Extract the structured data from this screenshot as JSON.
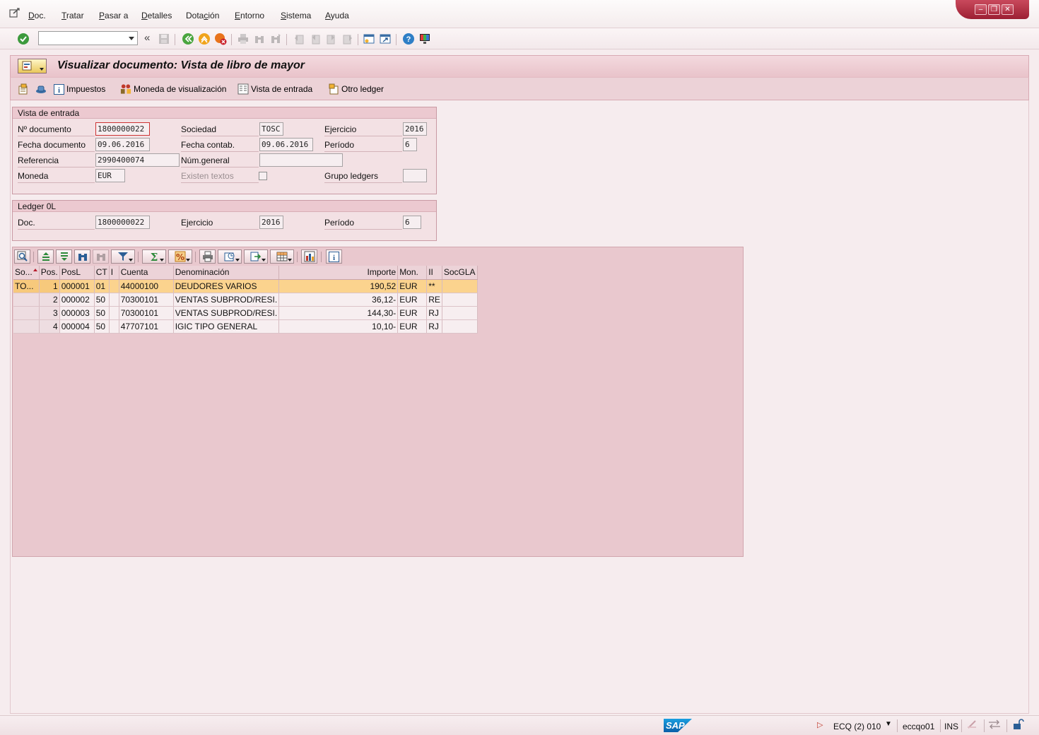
{
  "menubar": {
    "items": [
      {
        "pre": "",
        "u": "D",
        "post": "oc."
      },
      {
        "pre": "",
        "u": "T",
        "post": "ratar"
      },
      {
        "pre": "",
        "u": "P",
        "post": "asar a"
      },
      {
        "pre": "",
        "u": "D",
        "post": "etalles"
      },
      {
        "pre": "Dota",
        "u": "c",
        "post": "ión"
      },
      {
        "pre": "",
        "u": "E",
        "post": "ntorno"
      },
      {
        "pre": "",
        "u": "S",
        "post": "istema"
      },
      {
        "pre": "",
        "u": "A",
        "post": "yuda"
      }
    ]
  },
  "toolbar": {
    "command_value": ""
  },
  "title": "Visualizar documento: Vista de libro de mayor",
  "app_toolbar": {
    "impuestos": "Impuestos",
    "moneda": "Moneda de visualización",
    "vista_entrada": "Vista de entrada",
    "otro_ledger": "Otro ledger"
  },
  "entry_view": {
    "heading": "Vista de entrada",
    "doc_no_label": "Nº documento",
    "doc_no": "1800000022",
    "company_label": "Sociedad",
    "company": "TOSC",
    "fiscal_year_label": "Ejercicio",
    "fiscal_year": "2016",
    "doc_date_label": "Fecha documento",
    "doc_date": "09.06.2016",
    "posting_date_label": "Fecha contab.",
    "posting_date": "09.06.2016",
    "period_label": "Período",
    "period": "6",
    "reference_label": "Referencia",
    "reference": "2990400074",
    "crossco_label": "Núm.general",
    "crossco": "",
    "currency_label": "Moneda",
    "currency": "EUR",
    "texts_label": "Existen textos",
    "ledger_group_label": "Grupo ledgers",
    "ledger_group": ""
  },
  "ledger": {
    "heading": "Ledger 0L",
    "doc_label": "Doc.",
    "doc": "1800000022",
    "fiscal_year_label": "Ejercicio",
    "fiscal_year": "2016",
    "period_label": "Período",
    "period": "6"
  },
  "grid": {
    "columns": [
      "So...",
      "Pos.",
      "PosL",
      "CT",
      "I",
      "Cuenta",
      "Denominación",
      "Importe",
      "Mon.",
      "II",
      "SocGLA"
    ],
    "rows": [
      {
        "so": "TO...",
        "pos": "1",
        "posl": "000001",
        "ct": "01",
        "i": "",
        "cuenta": "44000100",
        "denom": "DEUDORES VARIOS",
        "importe": "190,52",
        "mon": "EUR",
        "ii": "**",
        "socgla": ""
      },
      {
        "so": "",
        "pos": "2",
        "posl": "000002",
        "ct": "50",
        "i": "",
        "cuenta": "70300101",
        "denom": "VENTAS SUBPROD/RESI.",
        "importe": "36,12-",
        "mon": "EUR",
        "ii": "RE",
        "socgla": ""
      },
      {
        "so": "",
        "pos": "3",
        "posl": "000003",
        "ct": "50",
        "i": "",
        "cuenta": "70300101",
        "denom": "VENTAS SUBPROD/RESI.",
        "importe": "144,30-",
        "mon": "EUR",
        "ii": "RJ",
        "socgla": ""
      },
      {
        "so": "",
        "pos": "4",
        "posl": "000004",
        "ct": "50",
        "i": "",
        "cuenta": "47707101",
        "denom": "IGIC TIPO GENERAL",
        "importe": "10,10-",
        "mon": "EUR",
        "ii": "RJ",
        "socgla": ""
      }
    ]
  },
  "status": {
    "system": "ECQ (2) 010",
    "server": "eccqo01",
    "mode": "INS",
    "logo": "SAP"
  },
  "colors": {
    "accent": "#9c1f33",
    "selected_row": "#fbd38e",
    "background": "#f6ecee"
  }
}
